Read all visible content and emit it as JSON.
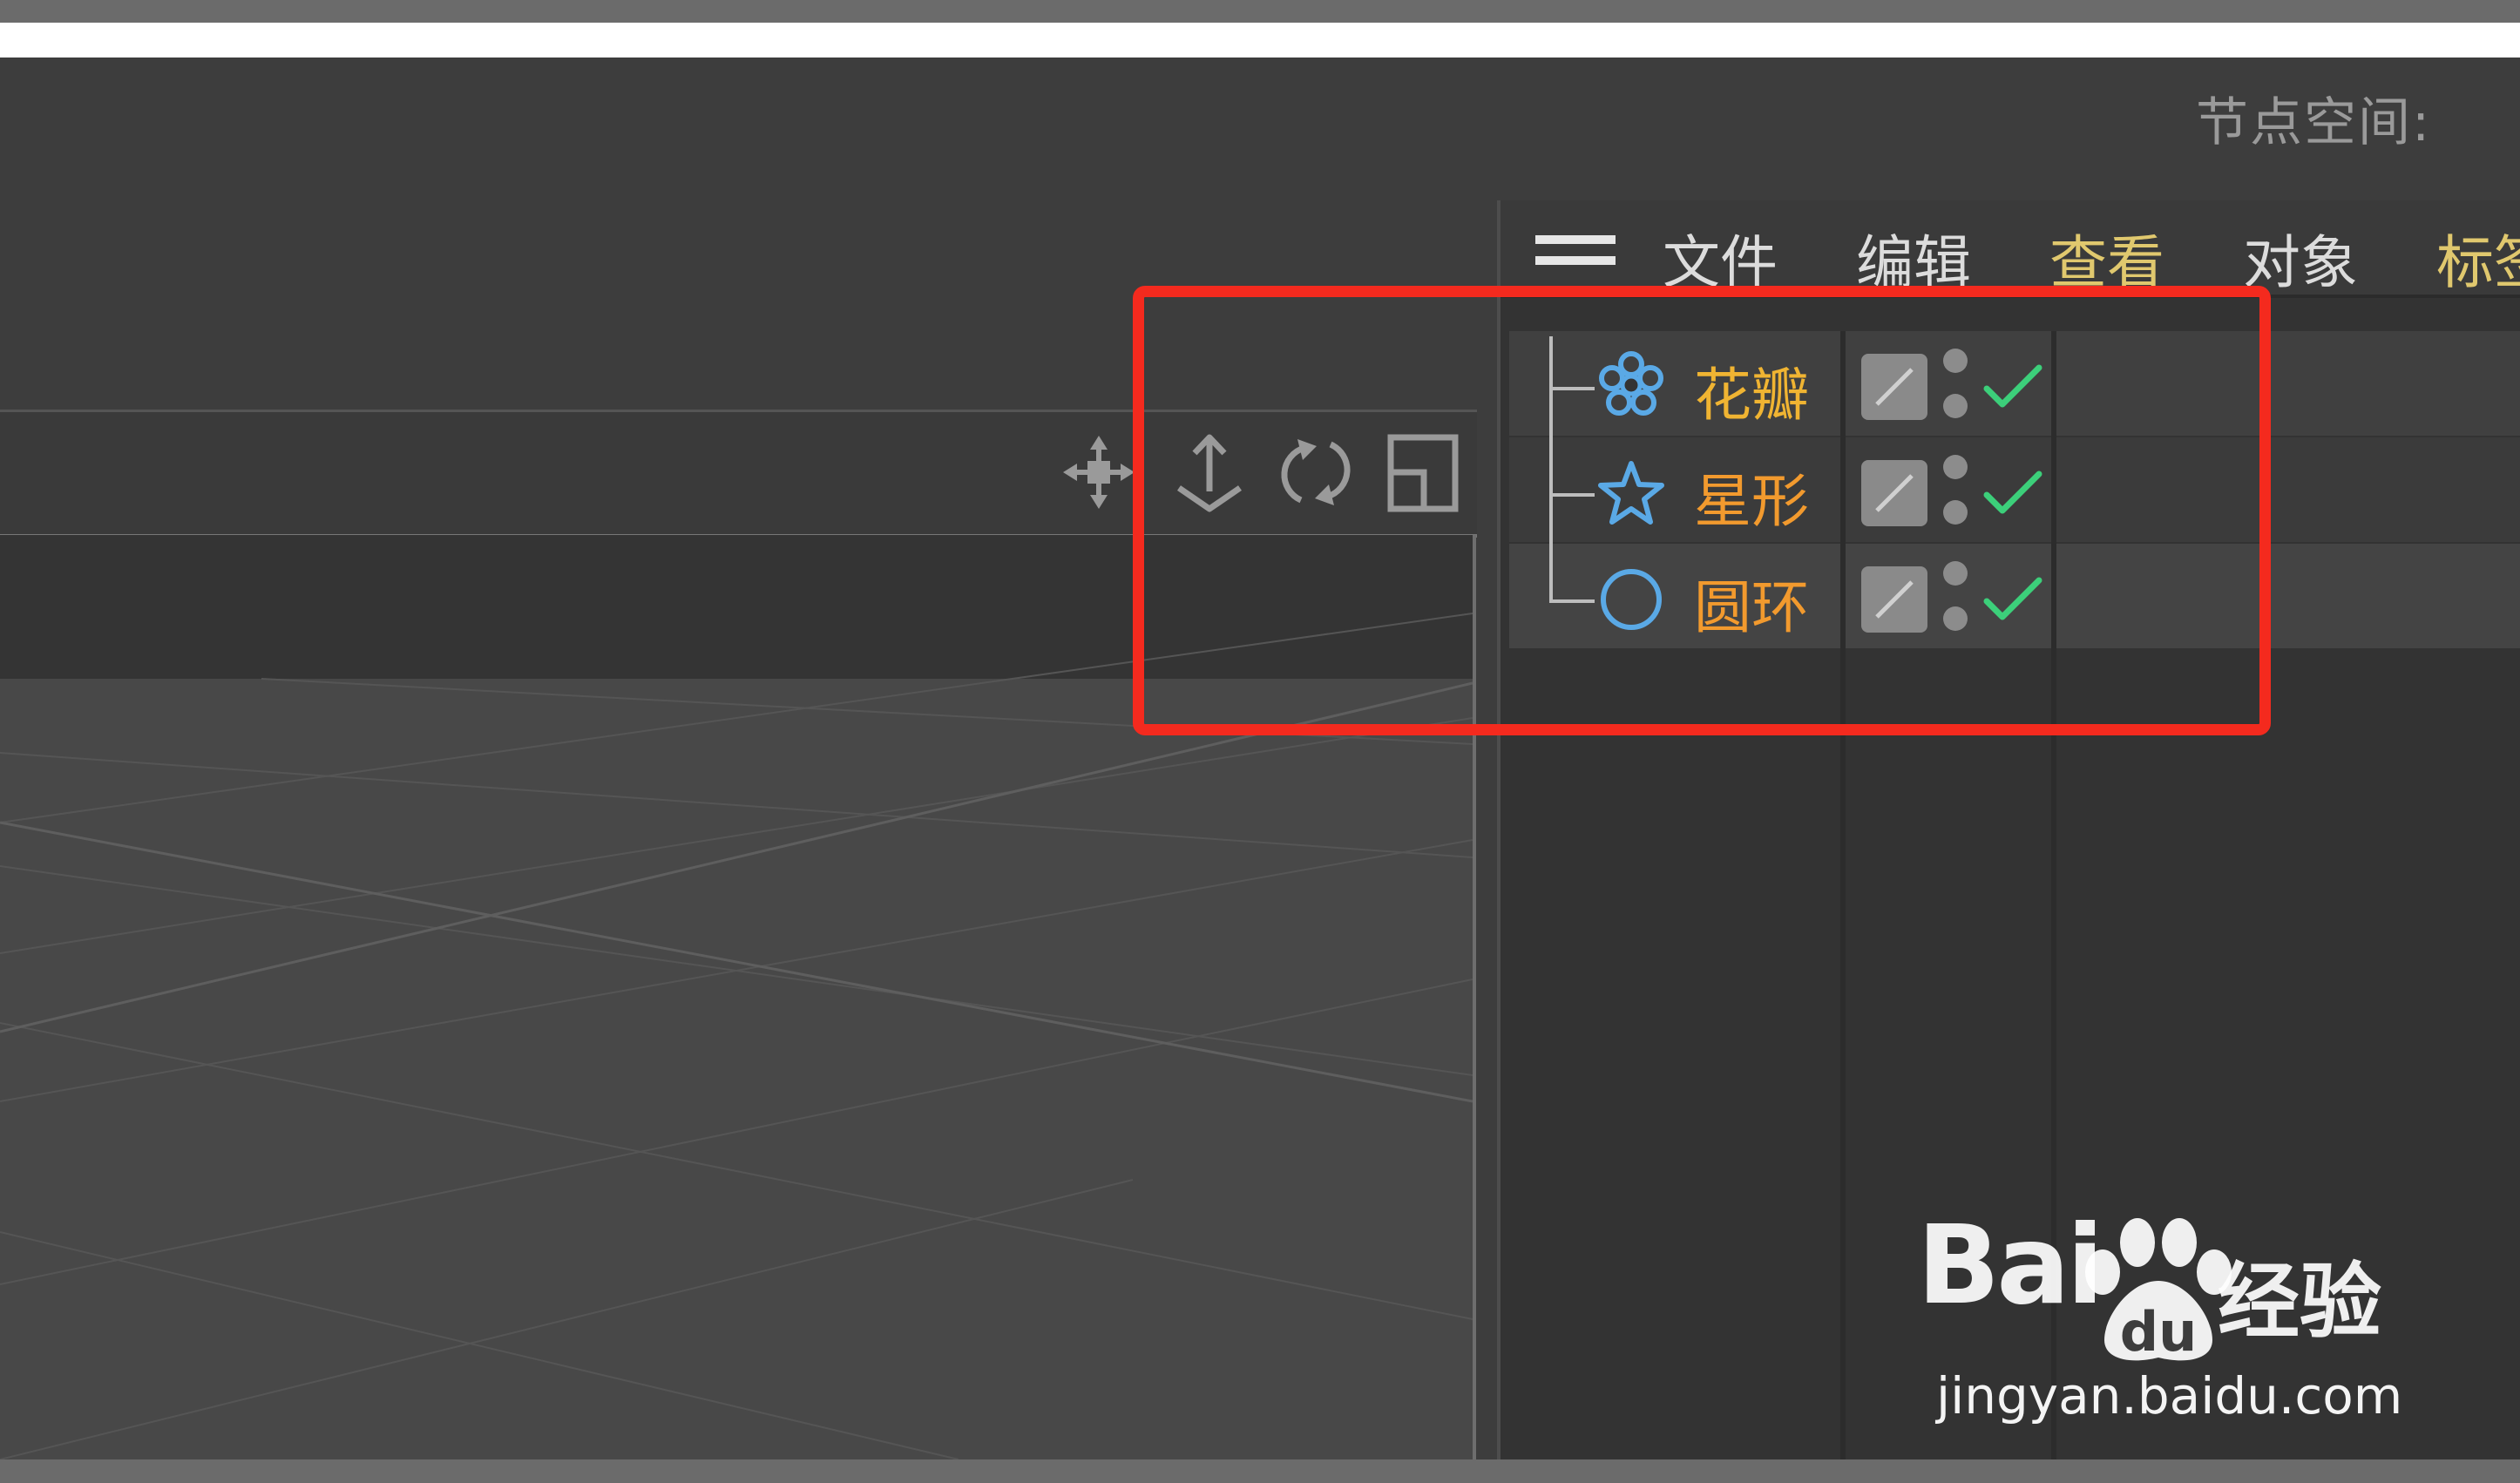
{
  "header": {
    "node_space_label": "节点空间:"
  },
  "object_manager": {
    "menu": {
      "file": "文件",
      "edit": "编辑",
      "view": "查看",
      "object": "对象",
      "tags": "标签"
    },
    "objects": [
      {
        "label": "花瓣",
        "icon": "flower-icon",
        "label_color": "#f0b432"
      },
      {
        "label": "星形",
        "icon": "star-icon",
        "label_color": "#f29a2e"
      },
      {
        "label": "圆环",
        "icon": "circle-icon",
        "label_color": "#f29a2e"
      }
    ]
  },
  "toolbar": {
    "icons": [
      "move-view-icon",
      "dolly-view-icon",
      "rotate-view-icon",
      "maximize-view-icon"
    ]
  },
  "colors": {
    "accent_highlight": "#f42a1e",
    "check_green": "#3ccf7a",
    "icon_blue": "#5aa9e6"
  },
  "watermark": {
    "brand": "Bai",
    "brand_du": "du",
    "product": "经验",
    "url": "jingyan.baidu.com"
  }
}
